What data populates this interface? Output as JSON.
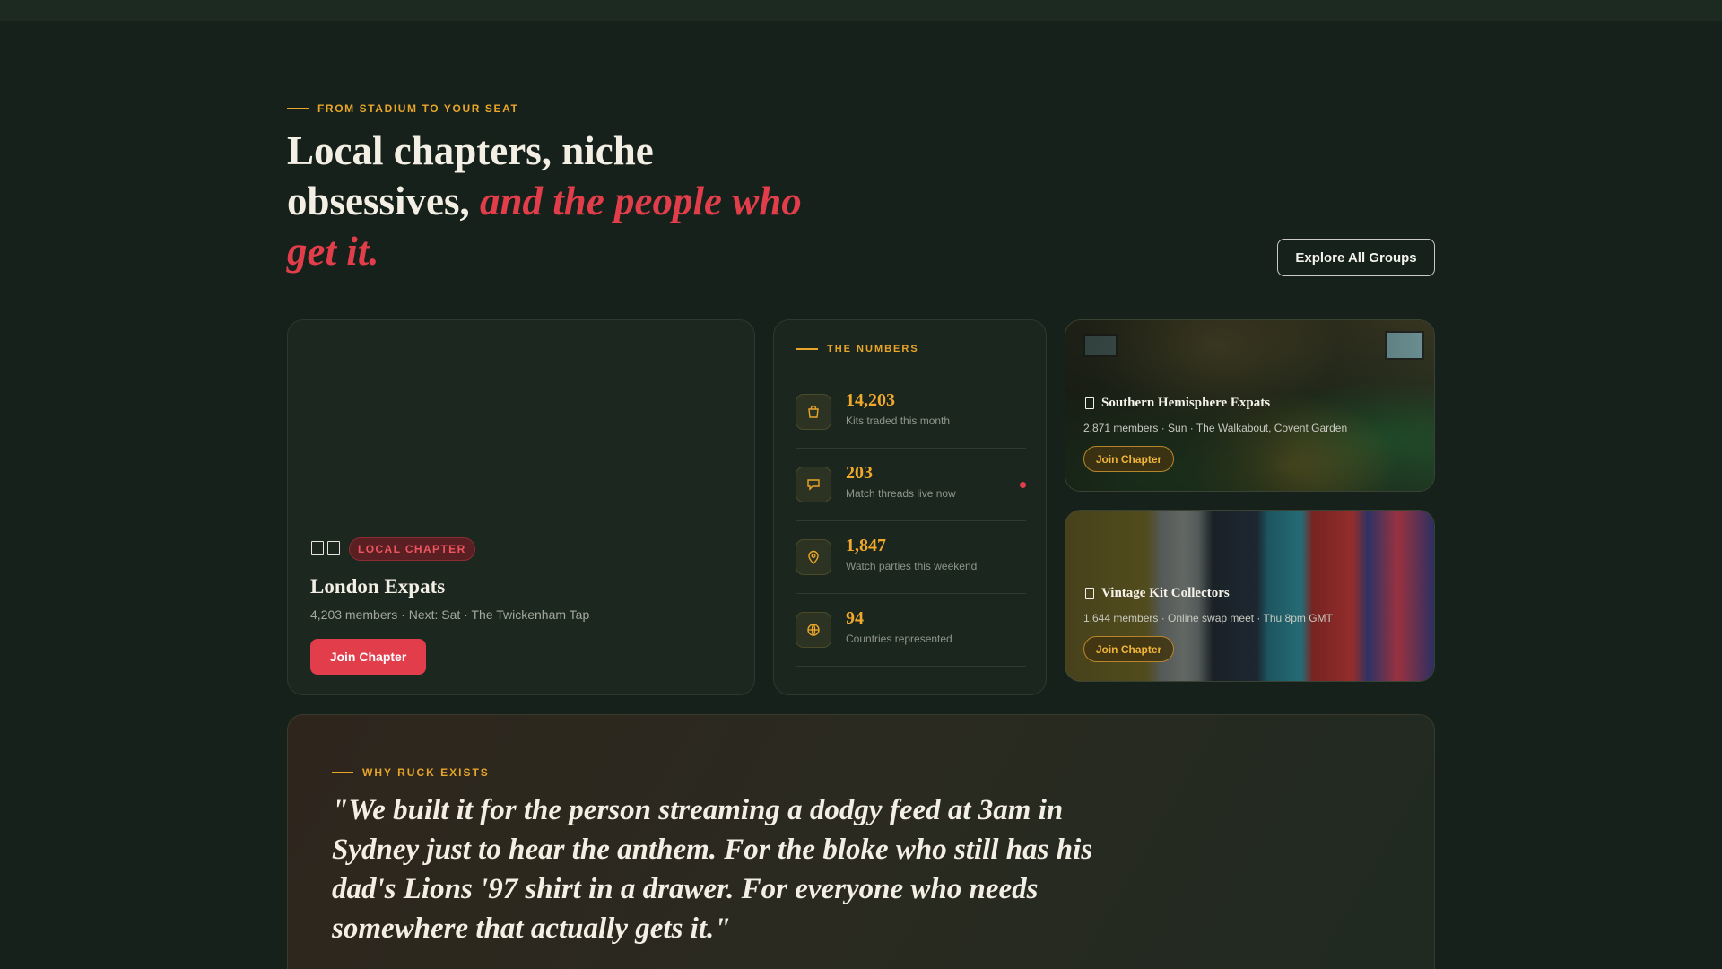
{
  "hero": {
    "eyebrow": "FROM STADIUM TO YOUR SEAT",
    "headline_plain": "Local chapters, niche obsessives, ",
    "headline_accent": "and the people who get it.",
    "explore_label": "Explore All Groups"
  },
  "london": {
    "badge": "LOCAL CHAPTER",
    "title": "London Expats",
    "meta": "4,203 members · Next: Sat · The Twickenham Tap",
    "join_label": "Join Chapter"
  },
  "numbers": {
    "eyebrow": "THE NUMBERS",
    "stats": [
      {
        "value": "14,203",
        "label": "Kits traded this month",
        "icon": "shopping-bag-icon"
      },
      {
        "value": "203",
        "label": "Match threads live now",
        "icon": "chat-icon",
        "live": true
      },
      {
        "value": "1,847",
        "label": "Watch parties this weekend",
        "icon": "map-pin-icon"
      },
      {
        "value": "94",
        "label": "Countries represented",
        "icon": "globe-icon"
      }
    ]
  },
  "groups": [
    {
      "title": "Southern Hemisphere Expats",
      "meta": "2,871 members · Sun · The Walkabout, Covent Garden",
      "join_label": "Join Chapter"
    },
    {
      "title": "Vintage Kit Collectors",
      "meta": "1,644 members · Online swap meet · Thu 8pm GMT",
      "join_label": "Join Chapter"
    }
  ],
  "why": {
    "eyebrow": "WHY RUCK EXISTS",
    "quote": "\"We built it for the person streaming a dodgy feed at 3am in Sydney just to hear the anthem. For the bloke who still has his dad's Lions '97 shirt in a drawer. For everyone who needs somewhere that actually gets it.\""
  },
  "colors": {
    "accent_red": "#e23d4b",
    "accent_gold": "#e9a52a",
    "background": "#15211a"
  }
}
